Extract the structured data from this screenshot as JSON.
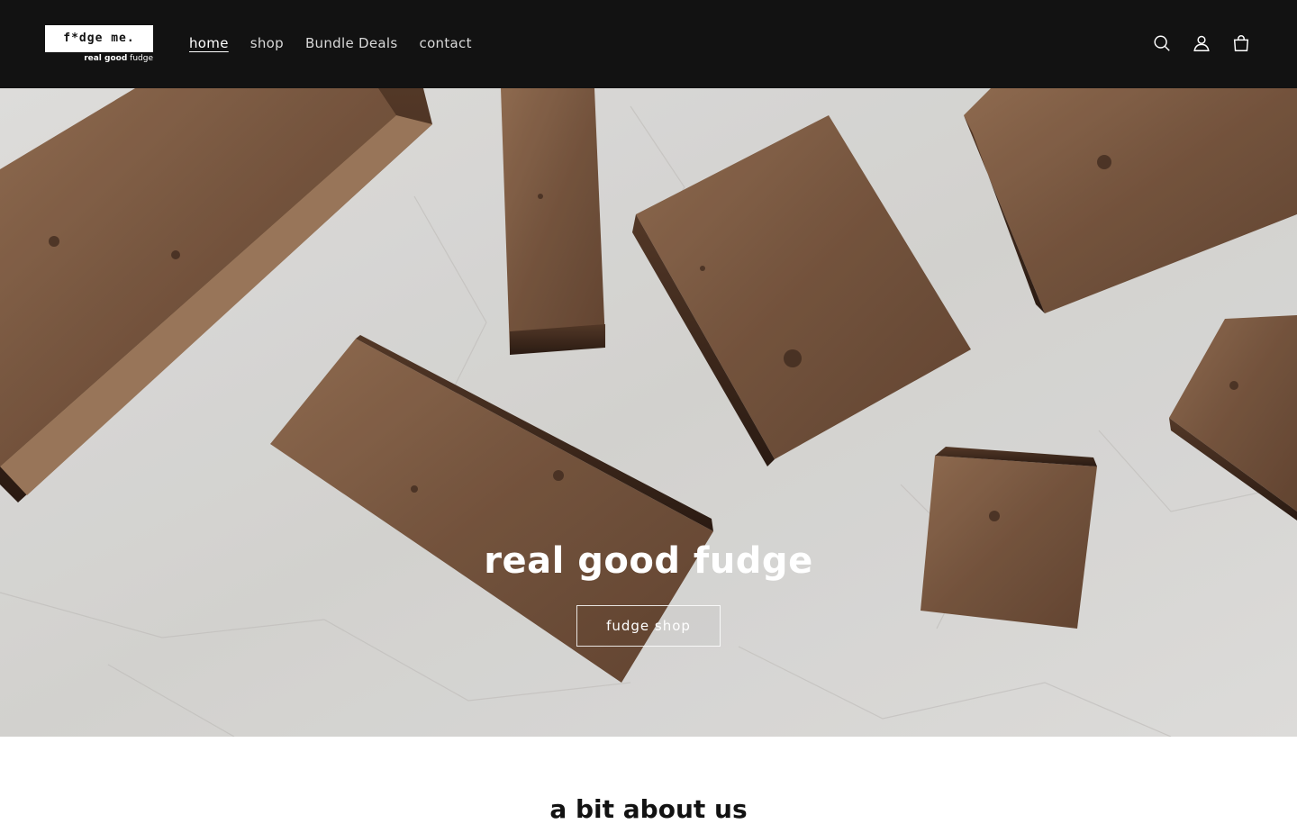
{
  "header": {
    "logo_text": "f*dge me.",
    "logo_tag_bold": "real good",
    "logo_tag_rest": "fudge",
    "nav": [
      {
        "label": "home",
        "active": true
      },
      {
        "label": "shop",
        "active": false
      },
      {
        "label": "Bundle Deals",
        "active": false
      },
      {
        "label": "contact",
        "active": false
      }
    ],
    "icons": [
      "search-icon",
      "account-icon",
      "cart-icon"
    ],
    "background": "#121212"
  },
  "hero": {
    "title": "real good fudge",
    "button_label": "fudge shop"
  },
  "about": {
    "title": "a bit about us"
  }
}
